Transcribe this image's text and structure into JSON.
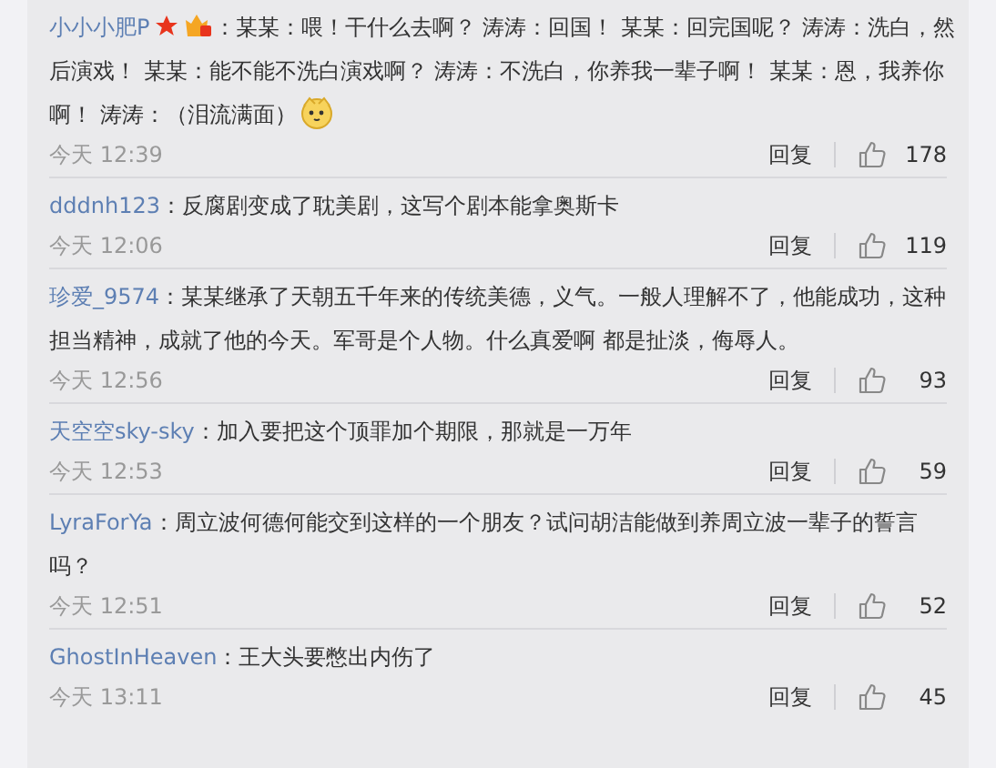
{
  "comments": [
    {
      "user": "小小小肥P",
      "badges": true,
      "text": "：某某：喂！干什么去啊？ 涛涛：回国！ 某某：回完国呢？ 涛涛：洗白，然后演戏！ 某某：能不能不洗白演戏啊？ 涛涛：不洗白，你养我一辈子啊！ 某某：恩，我养你啊！ 涛涛：（泪流满面）",
      "emoji": true,
      "time": "今天 12:39",
      "reply": "回复",
      "likes": "178"
    },
    {
      "user": "dddnh123",
      "badges": false,
      "text": "：反腐剧变成了耽美剧，这写个剧本能拿奥斯卡",
      "emoji": false,
      "time": "今天 12:06",
      "reply": "回复",
      "likes": "119"
    },
    {
      "user": "珍爱_9574",
      "badges": false,
      "text": "：某某继承了天朝五千年来的传统美德，义气。一般人理解不了，他能成功，这种担当精神，成就了他的今天。军哥是个人物。什么真爱啊 都是扯淡，侮辱人。",
      "emoji": false,
      "time": "今天 12:56",
      "reply": "回复",
      "likes": "93"
    },
    {
      "user": "天空空sky-sky",
      "badges": false,
      "text": "：加入要把这个顶罪加个期限，那就是一万年",
      "emoji": false,
      "time": "今天 12:53",
      "reply": "回复",
      "likes": "59"
    },
    {
      "user": "LyraForYa",
      "badges": false,
      "text": "：周立波何德何能交到这样的一个朋友？试问胡洁能做到养周立波一辈子的誓言吗？",
      "emoji": false,
      "time": "今天 12:51",
      "reply": "回复",
      "likes": "52"
    },
    {
      "user": "GhostInHeaven",
      "badges": false,
      "text": "：王大头要憋出内伤了",
      "emoji": false,
      "time": "今天 13:11",
      "reply": "回复",
      "likes": "45"
    }
  ]
}
